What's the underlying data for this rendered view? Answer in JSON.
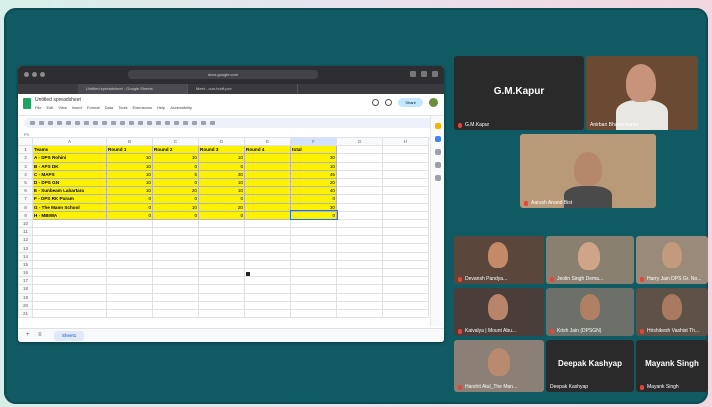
{
  "browser": {
    "url": "docs.google.com",
    "tabs": [
      "Untitled spreadsheet - Google Sheets",
      "Meet - cun-huhf-pvx"
    ]
  },
  "sheet": {
    "doc_title": "Untitled spreadsheet",
    "menu": [
      "File",
      "Edit",
      "View",
      "Insert",
      "Format",
      "Data",
      "Tools",
      "Extensions",
      "Help",
      "Accessibility"
    ],
    "share_label": "Share",
    "cell_ref": "F9",
    "columns": [
      "A",
      "B",
      "C",
      "D",
      "E",
      "F",
      "G",
      "H"
    ],
    "header_row": [
      "Teams",
      "Round 1",
      "Round 2",
      "Round 3",
      "Round 4",
      "total"
    ],
    "rows": [
      [
        "A - DPS Rohini",
        "10",
        "10",
        "10",
        "",
        "30"
      ],
      [
        "B - APS DK",
        "10",
        "0",
        "0",
        "",
        "10"
      ],
      [
        "C - MAPS",
        "10",
        "5",
        "30",
        "",
        "45"
      ],
      [
        "D - DPS GN",
        "10",
        "0",
        "10",
        "",
        "20"
      ],
      [
        "E - Sunbeam Lahartara",
        "10",
        "20",
        "10",
        "",
        "40"
      ],
      [
        "F - DPS RK Puram",
        "0",
        "0",
        "0",
        "",
        "0"
      ],
      [
        "G - The Mann School",
        "0",
        "10",
        "20",
        "",
        "30"
      ],
      [
        "H - MBIWA",
        "0",
        "0",
        "0",
        "",
        "0"
      ]
    ],
    "sheet_tab": "Sheet1"
  },
  "participants": {
    "gm_kapur": {
      "big": "G.M.Kapur",
      "label": "G.M.Kapur"
    },
    "anirban": {
      "label": "Anirban Bhattacharya"
    },
    "aarush": {
      "label": "Aarush Anand Bist"
    },
    "devansh": {
      "label": "Devansh Pandya..."
    },
    "jeolin": {
      "label": "Jeolin Singh Dema..."
    },
    "harry": {
      "label": "Harry Jain DPS Gr. No..."
    },
    "kaivalya": {
      "label": "Kaivalya | Mount Abu..."
    },
    "krish": {
      "label": "Krish Jain (DPSGN)"
    },
    "hrishikesh": {
      "label": "Hrishikesh Vashist Th..."
    },
    "harshit": {
      "label": "Harshit Atul_The Man..."
    },
    "deepak": {
      "big": "Deepak Kashyap",
      "label": "Deepak Kashyap"
    },
    "mayank": {
      "big": "Mayank Singh",
      "label": "Mayank Singh"
    }
  },
  "colors": {
    "frame": "#105a63",
    "highlight": "#fff200",
    "sheets_green": "#1ea362"
  }
}
